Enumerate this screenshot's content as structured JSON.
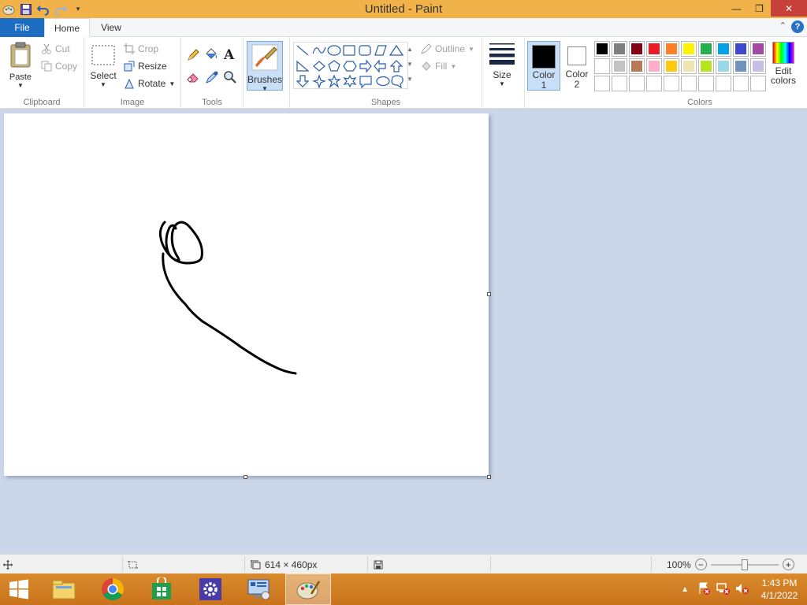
{
  "window": {
    "title": "Untitled - Paint",
    "controls": {
      "minimize": "—",
      "restore": "❐",
      "close": "✕"
    }
  },
  "tabs": [
    {
      "label": "File"
    },
    {
      "label": "Home"
    },
    {
      "label": "View"
    }
  ],
  "help": "?",
  "ribbon": {
    "clipboard": {
      "label": "Clipboard",
      "paste": "Paste",
      "cut": "Cut",
      "copy": "Copy"
    },
    "image": {
      "label": "Image",
      "select": "Select",
      "crop": "Crop",
      "resize": "Resize",
      "rotate": "Rotate"
    },
    "tools": {
      "label": "Tools"
    },
    "brushes": {
      "label": "Brushes"
    },
    "shapes": {
      "label": "Shapes",
      "outline": "Outline",
      "fill": "Fill"
    },
    "size": {
      "label": "Size"
    },
    "color1": {
      "label": "Color",
      "num": "1",
      "color": "#000000"
    },
    "color2": {
      "label": "Color",
      "num": "2",
      "color": "#ffffff"
    },
    "colors": {
      "label": "Colors",
      "edit_label_1": "Edit",
      "edit_label_2": "colors",
      "row1": [
        "#000000",
        "#7f7f7f",
        "#880015",
        "#ed1c24",
        "#ff7f27",
        "#fff200",
        "#22b14c",
        "#00a2e8",
        "#3f48cc",
        "#a349a4"
      ],
      "row2": [
        "#ffffff",
        "#c3c3c3",
        "#b97a57",
        "#ffaec9",
        "#ffc90e",
        "#efe4b0",
        "#b5e61d",
        "#99d9ea",
        "#7092be",
        "#c8bfe7"
      ],
      "row3": [
        "#ffffff",
        "#ffffff",
        "#ffffff",
        "#ffffff",
        "#ffffff",
        "#ffffff",
        "#ffffff",
        "#ffffff",
        "#ffffff",
        "#ffffff"
      ]
    }
  },
  "status": {
    "canvas_size": "614 × 460px",
    "zoom": "100%",
    "zoom_level": 0.5
  },
  "taskbar": {
    "time": "1:43 PM",
    "date": "4/1/2022"
  }
}
